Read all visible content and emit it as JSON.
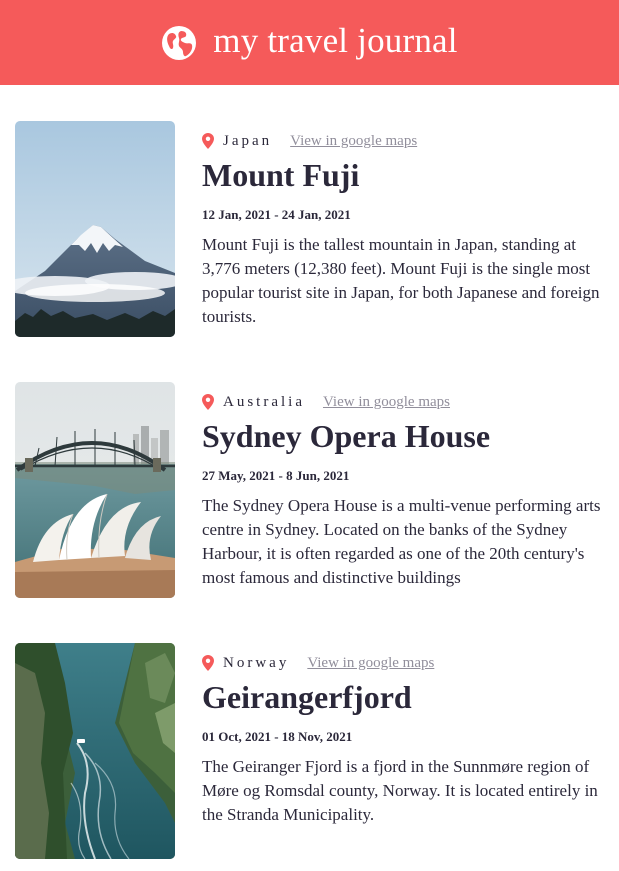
{
  "header": {
    "title": "my travel journal",
    "icon": "globe-icon",
    "background_color": "#f55a5a"
  },
  "entries": [
    {
      "country": "Japan",
      "maps_link_label": "View in google maps",
      "place": "Mount Fuji",
      "dates": "12 Jan, 2021 - 24 Jan, 2021",
      "description": "Mount Fuji is the tallest mountain in Japan, standing at 3,776 meters (12,380 feet). Mount Fuji is the single most popular tourist site in Japan, for both Japanese and foreign tourists.",
      "image": "mount-fuji-photo"
    },
    {
      "country": "Australia",
      "maps_link_label": "View in google maps",
      "place": "Sydney Opera House",
      "dates": "27 May, 2021 - 8 Jun, 2021",
      "description": "The Sydney Opera House is a multi-venue performing arts centre in Sydney. Located on the banks of the Sydney Harbour, it is often regarded as one of the 20th century's most famous and distinctive buildings",
      "image": "sydney-opera-house-photo"
    },
    {
      "country": "Norway",
      "maps_link_label": "View in google maps",
      "place": "Geirangerfjord",
      "dates": "01 Oct, 2021 - 18 Nov, 2021",
      "description": "The Geiranger Fjord is a fjord in the Sunnmøre region of Møre og Romsdal county, Norway. It is located entirely in the Stranda Municipality.",
      "image": "geirangerfjord-photo"
    }
  ]
}
